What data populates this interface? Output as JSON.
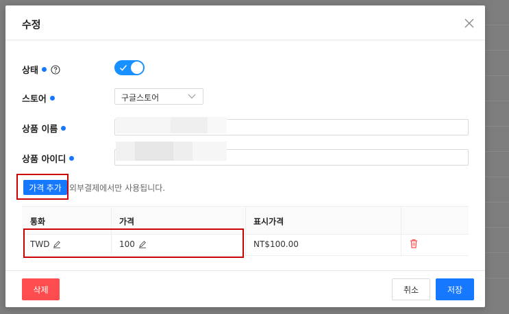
{
  "modal": {
    "title": "수정"
  },
  "form": {
    "status_label": "상태",
    "store_label": "스토어",
    "store_value": "구글스토어",
    "product_name_label": "상품 이름",
    "product_id_label": "상품 아이디",
    "add_price_button": "가격 추가",
    "note": "외부결제에서만 사용됩니다."
  },
  "table": {
    "headers": [
      "통화",
      "가격",
      "표시가격",
      ""
    ],
    "rows": [
      {
        "currency": "TWD",
        "price": "100",
        "display_price": "NT$100.00"
      }
    ]
  },
  "footer": {
    "delete_label": "삭제",
    "cancel_label": "취소",
    "save_label": "저장"
  },
  "colors": {
    "primary": "#1677ff",
    "danger": "#ff4d4f",
    "highlight": "#cc0000"
  }
}
